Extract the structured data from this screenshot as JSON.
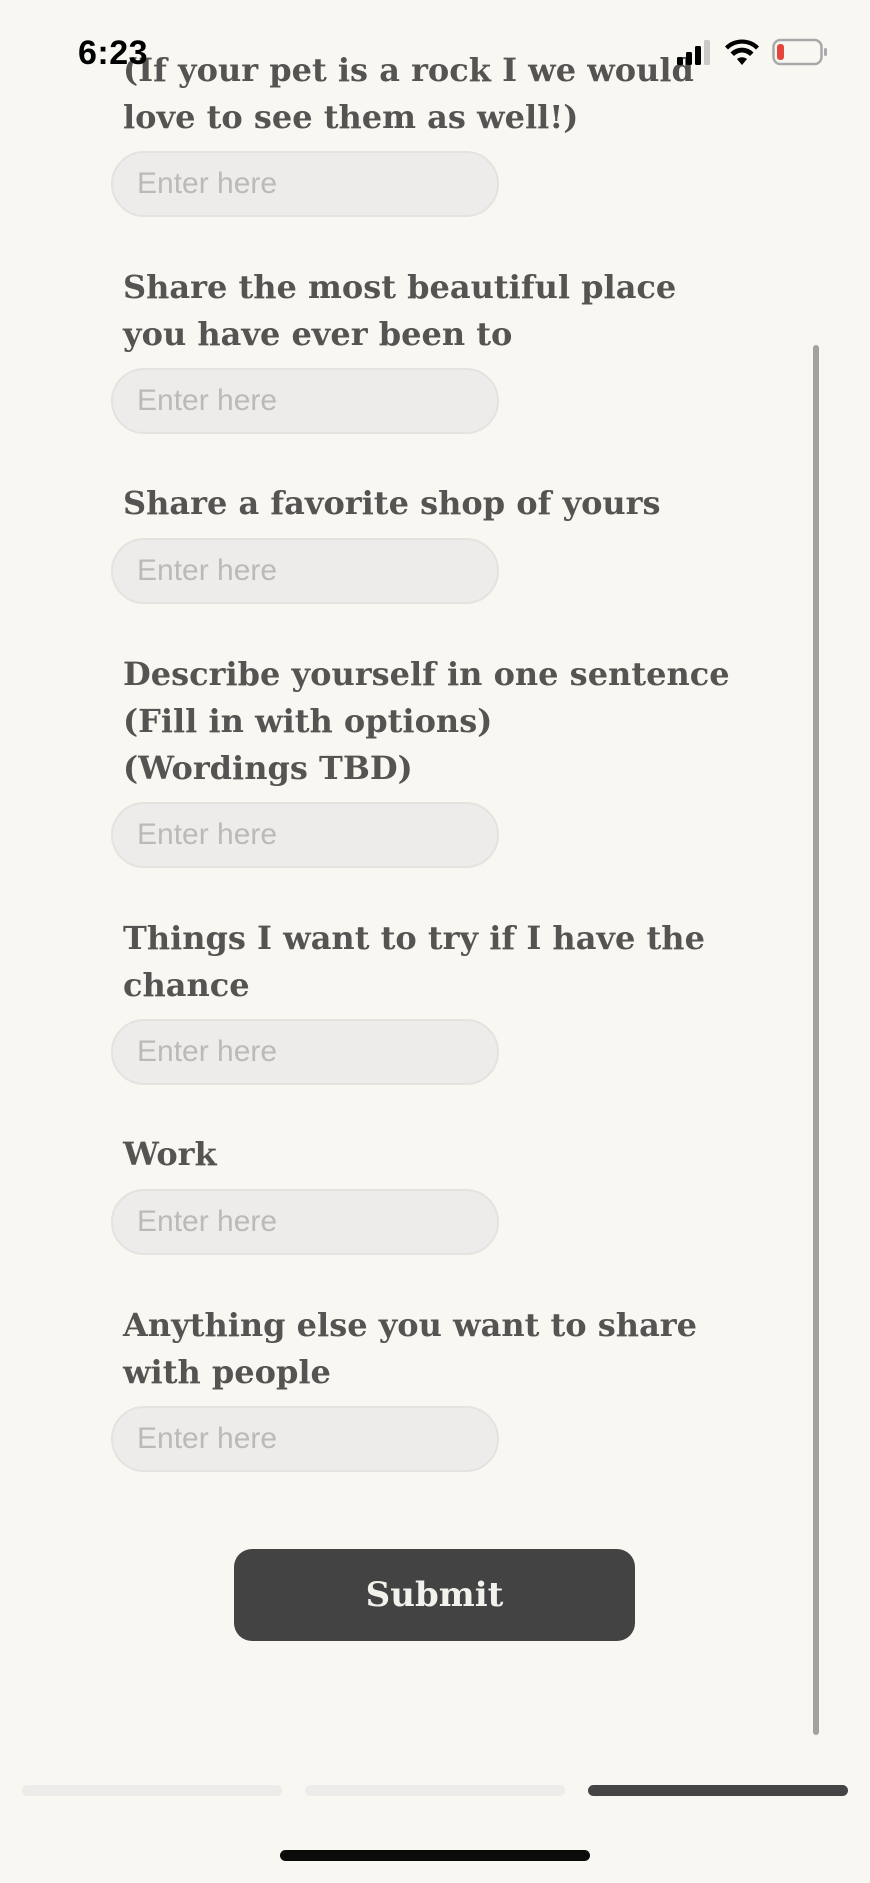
{
  "status_bar": {
    "time": "6:23",
    "icons": [
      "cellular-signal-icon",
      "wifi-icon",
      "battery-low-icon"
    ]
  },
  "form": {
    "questions": [
      {
        "label": "(If your pet is a rock I we would love to see them as well!)",
        "placeholder": "Enter here"
      },
      {
        "label": "Share the most beautiful place you have ever been to",
        "placeholder": "Enter here"
      },
      {
        "label": "Share a favorite shop of yours",
        "placeholder": "Enter here"
      },
      {
        "label": "Describe yourself in one sentence\n(Fill in with options)\n(Wordings TBD)",
        "placeholder": "Enter here"
      },
      {
        "label": "Things I want to try if I have the chance",
        "placeholder": "Enter here"
      },
      {
        "label": "Work",
        "placeholder": "Enter here"
      },
      {
        "label": "Anything else you want to share with people",
        "placeholder": "Enter here"
      }
    ],
    "submit_label": "Submit"
  },
  "progress": {
    "total_steps": 3,
    "current_step": 3
  },
  "colors": {
    "background": "#f8f7f2",
    "label_text": "#565452",
    "field_bg": "#eeebeb",
    "button_bg": "#434343",
    "battery_low": "#e5463c"
  }
}
